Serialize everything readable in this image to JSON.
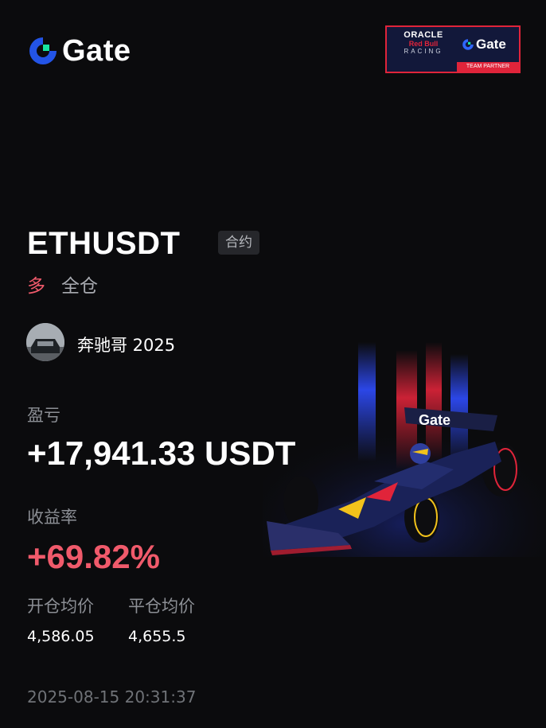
{
  "brand": {
    "name": "Gate",
    "logo_icon": "gate-logo-icon"
  },
  "partner_badge": {
    "line1": "ORACLE",
    "line2": "Red Bull",
    "line3": "RACING",
    "gate": "Gate",
    "footer": "TEAM PARTNER"
  },
  "position": {
    "pair": "ETHUSDT",
    "type_tag": "合约",
    "direction": "多",
    "margin_mode": "全仓"
  },
  "user": {
    "name": "奔驰哥 2025"
  },
  "pnl": {
    "label": "盈亏",
    "value": "+17,941.33 USDT"
  },
  "roi": {
    "label": "收益率",
    "value": "+69.82%"
  },
  "prices": {
    "open_label": "开仓均价",
    "open_value": "4,586.05",
    "close_label": "平仓均价",
    "close_value": "4,655.5"
  },
  "timestamp": "2025-08-15 20:31:37",
  "colors": {
    "background": "#0b0b0d",
    "long_red": "#f05a6b",
    "brand_blue": "#2354e6",
    "brand_green": "#17e6a1",
    "muted": "#8c8f95"
  },
  "car_banner_text": "Gate"
}
